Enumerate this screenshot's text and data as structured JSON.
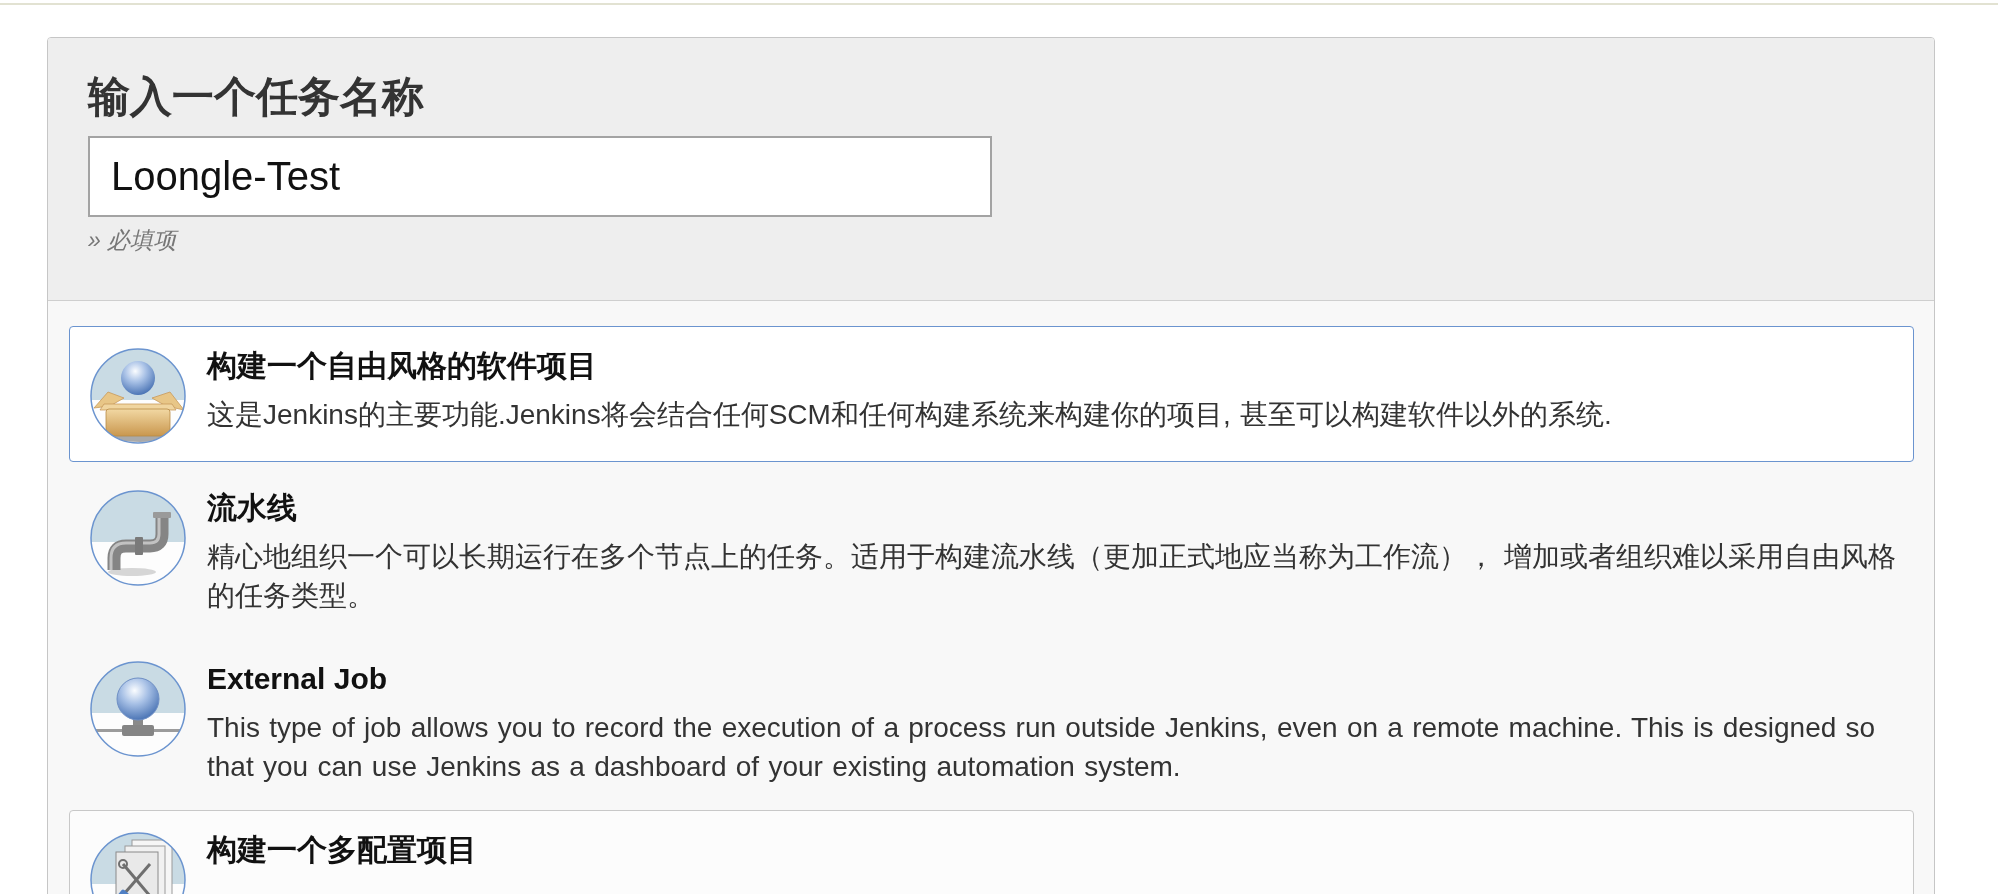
{
  "header": {
    "title": "输入一个任务名称",
    "job_name": {
      "value": "Loongle-Test"
    },
    "hint": "» 必填项"
  },
  "items": [
    {
      "title": "构建一个自由风格的软件项目",
      "description": "这是Jenkins的主要功能.Jenkins将会结合任何SCM和任何构建系统来构建你的项目, 甚至可以构建软件以外的系统.",
      "selected": true,
      "hovered": false
    },
    {
      "title": "流水线",
      "description": "精心地组织一个可以长期运行在多个节点上的任务。适用于构建流水线（更加正式地应当称为工作流）， 增加或者组织难以采用自由风格的任务类型。",
      "selected": false,
      "hovered": false
    },
    {
      "title": "External Job",
      "description": "This type of job allows you to record the execution of a process run outside Jenkins, even on a remote machine. This is designed so that you can use Jenkins as a dashboard of your existing automation system.",
      "selected": false,
      "hovered": false
    },
    {
      "title": "构建一个多配置项目",
      "selected": false,
      "hovered": true
    }
  ]
}
